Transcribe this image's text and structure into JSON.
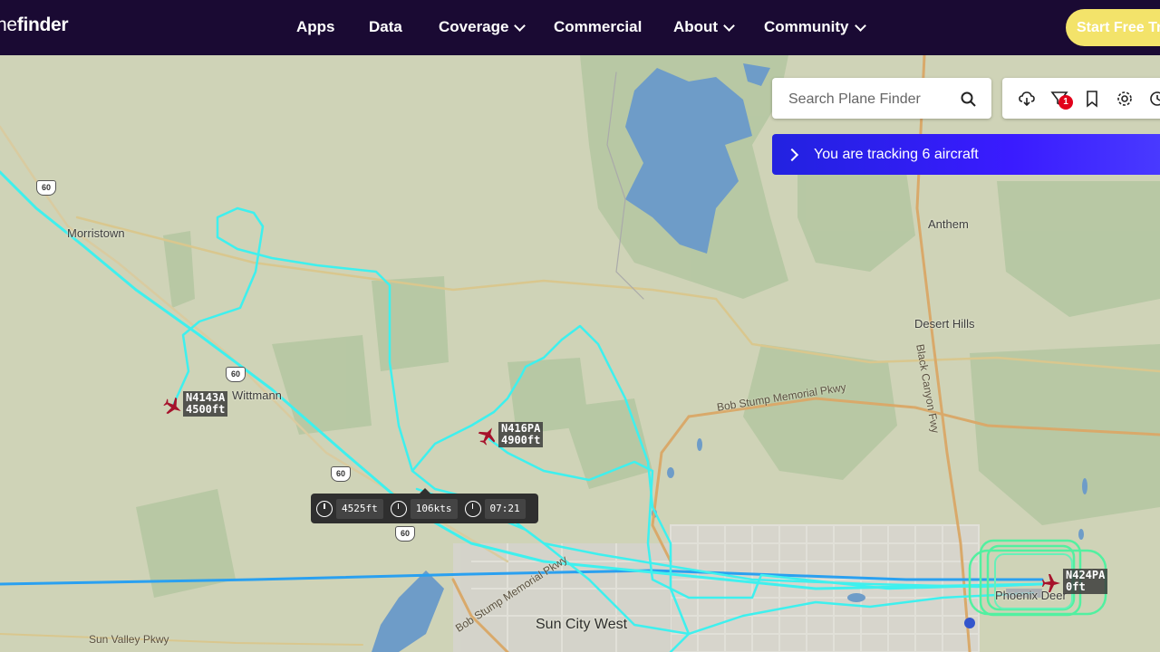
{
  "brand": {
    "text_light": "ne",
    "text_bold": "finder",
    "full": "nefinder"
  },
  "nav": {
    "items": [
      {
        "label": "Apps",
        "dropdown": false
      },
      {
        "label": "Data",
        "dropdown": false
      },
      {
        "label": "Coverage",
        "dropdown": true
      },
      {
        "label": "Commercial",
        "dropdown": false
      },
      {
        "label": "About",
        "dropdown": true
      },
      {
        "label": "Community",
        "dropdown": true
      }
    ],
    "cta_label": "Start Free Tr"
  },
  "search": {
    "placeholder": "Search Plane Finder"
  },
  "toolbar": {
    "icons": [
      "weather-cloud-icon",
      "filter-icon",
      "bookmark-icon",
      "settings-gear-icon",
      "history-icon"
    ],
    "filter_count": "1"
  },
  "tracking": {
    "label": "You are tracking 6 aircraft"
  },
  "places": {
    "morristown": "Morristown",
    "wittmann": "Wittmann",
    "anthem": "Anthem",
    "desert_hills": "Desert Hills",
    "sun_city_west": "Sun City West",
    "phoenix_deer": "Phoenix Deer",
    "sun_valley": "Sun Valley Pkwy",
    "bob_stump_1": "Bob Stump Memorial Pkwy",
    "bob_stump_2": "Bob Stump Memorial Pkwy",
    "black_canyon": "Black Canyon Fwy"
  },
  "shields": {
    "us60": "60"
  },
  "aircraft": [
    {
      "callsign": "N4143A",
      "altitude": "4500ft"
    },
    {
      "callsign": "N416PA",
      "altitude": "4900ft"
    },
    {
      "callsign": "N424PA",
      "altitude": "0ft"
    }
  ],
  "info": {
    "altitude": "4525ft",
    "speed": "106kts",
    "time": "07:21"
  },
  "colors": {
    "nav_bg": "#1a0a33",
    "cta": "#f3e36a",
    "track": "#3ef0ee",
    "track_alt": "#2aa0f0",
    "track_green": "#52f0a0",
    "plane": "#a6122b",
    "water": "#6e9cc8",
    "banner": "#3322ee"
  }
}
